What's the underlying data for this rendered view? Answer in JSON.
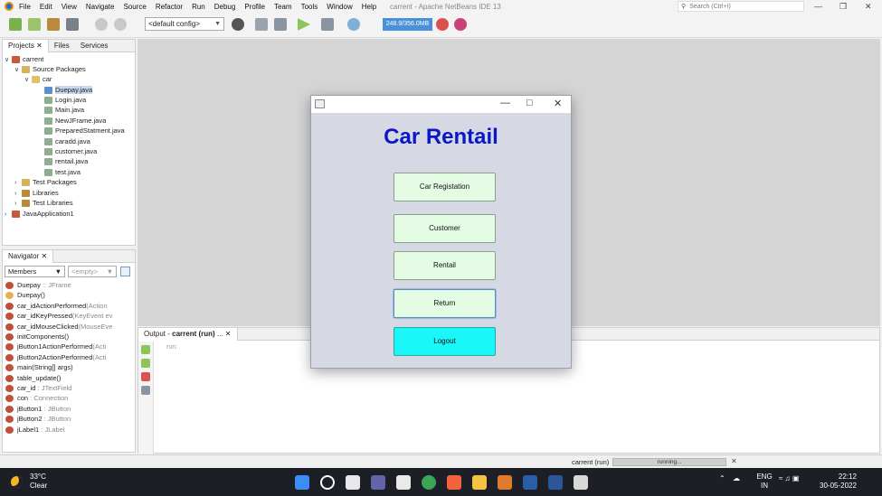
{
  "ide": {
    "menu": [
      "File",
      "Edit",
      "View",
      "Navigate",
      "Source",
      "Refactor",
      "Run",
      "Debug",
      "Profile",
      "Team",
      "Tools",
      "Window",
      "Help"
    ],
    "window_title": "carrent - Apache NetBeans IDE 13",
    "search_placeholder": "Search (Ctrl+I)",
    "config": "<default config>",
    "memory": "248.9/356.0MB"
  },
  "projects": {
    "tabs": [
      "Projects",
      "Files",
      "Services"
    ],
    "tree": [
      {
        "label": "carrent",
        "icon": "project-icon"
      },
      {
        "label": "Source Packages",
        "icon": "package-folder-icon"
      },
      {
        "label": "car",
        "icon": "package-icon"
      },
      {
        "label": "Duepay.java",
        "icon": "java-file-icon",
        "selected": true
      },
      {
        "label": "Login.java",
        "icon": "java-file-icon"
      },
      {
        "label": "Main.java",
        "icon": "java-file-icon"
      },
      {
        "label": "NewJFrame.java",
        "icon": "java-file-icon"
      },
      {
        "label": "PreparedStatment.java",
        "icon": "java-file-icon"
      },
      {
        "label": "caradd.java",
        "icon": "java-file-icon"
      },
      {
        "label": "customer.java",
        "icon": "java-file-icon"
      },
      {
        "label": "rentail.java",
        "icon": "java-file-icon"
      },
      {
        "label": "test.java",
        "icon": "java-file-icon"
      },
      {
        "label": "Test Packages",
        "icon": "package-folder-icon"
      },
      {
        "label": "Libraries",
        "icon": "library-icon"
      },
      {
        "label": "Test Libraries",
        "icon": "library-icon"
      },
      {
        "label": "JavaApplication1",
        "icon": "project-icon"
      }
    ]
  },
  "navigator": {
    "title": "Navigator",
    "filter": "Members",
    "filter2": "<empty>",
    "items": [
      {
        "name": "Duepay",
        "type": " :: JFrame"
      },
      {
        "name": "Duepay()",
        "type": ""
      },
      {
        "name": "car_idActionPerformed",
        "type": "(Action"
      },
      {
        "name": "car_idKeyPressed",
        "type": "(KeyEvent ev"
      },
      {
        "name": "car_idMouseClicked",
        "type": "(MouseEve"
      },
      {
        "name": "initComponents()",
        "type": ""
      },
      {
        "name": "jButton1ActionPerformed",
        "type": "(Acti"
      },
      {
        "name": "jButton2ActionPerformed",
        "type": "(Acti"
      },
      {
        "name": "main(String[] args)",
        "type": ""
      },
      {
        "name": "table_update()",
        "type": ""
      },
      {
        "name": "car_id",
        "type": " : JTextField"
      },
      {
        "name": "con",
        "type": " : Connection"
      },
      {
        "name": "jButton1",
        "type": " : JButton"
      },
      {
        "name": "jButton2",
        "type": " : JButton"
      },
      {
        "name": "jLabel1",
        "type": " : JLabel"
      }
    ]
  },
  "output": {
    "prefix": "Output - ",
    "name": "carrent (run)",
    "suffix": " ...",
    "line": "run:"
  },
  "status": {
    "run_label": "carrent (run)",
    "progress_text": "running..."
  },
  "dialog": {
    "heading": "Car Rentail",
    "buttons": [
      "Car Registation",
      "Customer",
      "Rentail",
      "Return",
      "Logout"
    ]
  },
  "taskbar": {
    "temp": "33°C",
    "weather": "Clear",
    "lang1": "ENG",
    "lang2": "IN",
    "time": "22:12",
    "date": "30-05-2022"
  }
}
